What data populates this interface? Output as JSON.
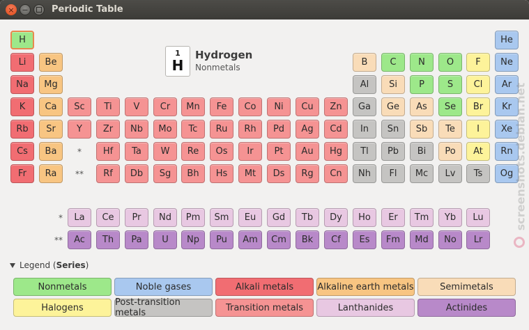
{
  "window": {
    "title": "Periodic Table"
  },
  "selected": {
    "number": "1",
    "symbol": "H",
    "name": "Hydrogen",
    "series": "Nonmetals"
  },
  "legend": {
    "toggle_prefix": "Legend (",
    "toggle_bold": "Series",
    "toggle_suffix": ")",
    "items": [
      {
        "label": "Nonmetals",
        "cls": "c-nonmetal"
      },
      {
        "label": "Noble gases",
        "cls": "c-noble"
      },
      {
        "label": "Alkali metals",
        "cls": "c-alkali"
      },
      {
        "label": "Alkaline earth metals",
        "cls": "c-alkaline"
      },
      {
        "label": "Semimetals",
        "cls": "c-semimetal"
      },
      {
        "label": "Halogens",
        "cls": "c-halogen"
      },
      {
        "label": "Post-transition metals",
        "cls": "c-post"
      },
      {
        "label": "Transition metals",
        "cls": "c-transition"
      },
      {
        "label": "Lanthanides",
        "cls": "c-lanth"
      },
      {
        "label": "Actinides",
        "cls": "c-actin"
      }
    ]
  },
  "markers": {
    "lanthanide": "*",
    "actinide": "**"
  },
  "watermark": "screenshots.debian.net",
  "elements": [
    {
      "s": "H",
      "r": 1,
      "c": 1,
      "t": "c-nonmetal",
      "sel": true
    },
    {
      "s": "He",
      "r": 1,
      "c": 18,
      "t": "c-noble"
    },
    {
      "s": "Li",
      "r": 2,
      "c": 1,
      "t": "c-alkali"
    },
    {
      "s": "Be",
      "r": 2,
      "c": 2,
      "t": "c-alkaline"
    },
    {
      "s": "B",
      "r": 2,
      "c": 13,
      "t": "c-semimetal"
    },
    {
      "s": "C",
      "r": 2,
      "c": 14,
      "t": "c-nonmetal"
    },
    {
      "s": "N",
      "r": 2,
      "c": 15,
      "t": "c-nonmetal"
    },
    {
      "s": "O",
      "r": 2,
      "c": 16,
      "t": "c-nonmetal"
    },
    {
      "s": "F",
      "r": 2,
      "c": 17,
      "t": "c-halogen"
    },
    {
      "s": "Ne",
      "r": 2,
      "c": 18,
      "t": "c-noble"
    },
    {
      "s": "Na",
      "r": 3,
      "c": 1,
      "t": "c-alkali"
    },
    {
      "s": "Mg",
      "r": 3,
      "c": 2,
      "t": "c-alkaline"
    },
    {
      "s": "Al",
      "r": 3,
      "c": 13,
      "t": "c-post"
    },
    {
      "s": "Si",
      "r": 3,
      "c": 14,
      "t": "c-semimetal"
    },
    {
      "s": "P",
      "r": 3,
      "c": 15,
      "t": "c-nonmetal"
    },
    {
      "s": "S",
      "r": 3,
      "c": 16,
      "t": "c-nonmetal"
    },
    {
      "s": "Cl",
      "r": 3,
      "c": 17,
      "t": "c-halogen"
    },
    {
      "s": "Ar",
      "r": 3,
      "c": 18,
      "t": "c-noble"
    },
    {
      "s": "K",
      "r": 4,
      "c": 1,
      "t": "c-alkali"
    },
    {
      "s": "Ca",
      "r": 4,
      "c": 2,
      "t": "c-alkaline"
    },
    {
      "s": "Sc",
      "r": 4,
      "c": 3,
      "t": "c-transition"
    },
    {
      "s": "Ti",
      "r": 4,
      "c": 4,
      "t": "c-transition"
    },
    {
      "s": "V",
      "r": 4,
      "c": 5,
      "t": "c-transition"
    },
    {
      "s": "Cr",
      "r": 4,
      "c": 6,
      "t": "c-transition"
    },
    {
      "s": "Mn",
      "r": 4,
      "c": 7,
      "t": "c-transition"
    },
    {
      "s": "Fe",
      "r": 4,
      "c": 8,
      "t": "c-transition"
    },
    {
      "s": "Co",
      "r": 4,
      "c": 9,
      "t": "c-transition"
    },
    {
      "s": "Ni",
      "r": 4,
      "c": 10,
      "t": "c-transition"
    },
    {
      "s": "Cu",
      "r": 4,
      "c": 11,
      "t": "c-transition"
    },
    {
      "s": "Zn",
      "r": 4,
      "c": 12,
      "t": "c-transition"
    },
    {
      "s": "Ga",
      "r": 4,
      "c": 13,
      "t": "c-post"
    },
    {
      "s": "Ge",
      "r": 4,
      "c": 14,
      "t": "c-semimetal"
    },
    {
      "s": "As",
      "r": 4,
      "c": 15,
      "t": "c-semimetal"
    },
    {
      "s": "Se",
      "r": 4,
      "c": 16,
      "t": "c-nonmetal"
    },
    {
      "s": "Br",
      "r": 4,
      "c": 17,
      "t": "c-halogen"
    },
    {
      "s": "Kr",
      "r": 4,
      "c": 18,
      "t": "c-noble"
    },
    {
      "s": "Rb",
      "r": 5,
      "c": 1,
      "t": "c-alkali"
    },
    {
      "s": "Sr",
      "r": 5,
      "c": 2,
      "t": "c-alkaline"
    },
    {
      "s": "Y",
      "r": 5,
      "c": 3,
      "t": "c-transition"
    },
    {
      "s": "Zr",
      "r": 5,
      "c": 4,
      "t": "c-transition"
    },
    {
      "s": "Nb",
      "r": 5,
      "c": 5,
      "t": "c-transition"
    },
    {
      "s": "Mo",
      "r": 5,
      "c": 6,
      "t": "c-transition"
    },
    {
      "s": "Tc",
      "r": 5,
      "c": 7,
      "t": "c-transition"
    },
    {
      "s": "Ru",
      "r": 5,
      "c": 8,
      "t": "c-transition"
    },
    {
      "s": "Rh",
      "r": 5,
      "c": 9,
      "t": "c-transition"
    },
    {
      "s": "Pd",
      "r": 5,
      "c": 10,
      "t": "c-transition"
    },
    {
      "s": "Ag",
      "r": 5,
      "c": 11,
      "t": "c-transition"
    },
    {
      "s": "Cd",
      "r": 5,
      "c": 12,
      "t": "c-transition"
    },
    {
      "s": "In",
      "r": 5,
      "c": 13,
      "t": "c-post"
    },
    {
      "s": "Sn",
      "r": 5,
      "c": 14,
      "t": "c-post"
    },
    {
      "s": "Sb",
      "r": 5,
      "c": 15,
      "t": "c-semimetal"
    },
    {
      "s": "Te",
      "r": 5,
      "c": 16,
      "t": "c-semimetal"
    },
    {
      "s": "I",
      "r": 5,
      "c": 17,
      "t": "c-halogen"
    },
    {
      "s": "Xe",
      "r": 5,
      "c": 18,
      "t": "c-noble"
    },
    {
      "s": "Cs",
      "r": 6,
      "c": 1,
      "t": "c-alkali"
    },
    {
      "s": "Ba",
      "r": 6,
      "c": 2,
      "t": "c-alkaline"
    },
    {
      "s": "Hf",
      "r": 6,
      "c": 4,
      "t": "c-transition"
    },
    {
      "s": "Ta",
      "r": 6,
      "c": 5,
      "t": "c-transition"
    },
    {
      "s": "W",
      "r": 6,
      "c": 6,
      "t": "c-transition"
    },
    {
      "s": "Re",
      "r": 6,
      "c": 7,
      "t": "c-transition"
    },
    {
      "s": "Os",
      "r": 6,
      "c": 8,
      "t": "c-transition"
    },
    {
      "s": "Ir",
      "r": 6,
      "c": 9,
      "t": "c-transition"
    },
    {
      "s": "Pt",
      "r": 6,
      "c": 10,
      "t": "c-transition"
    },
    {
      "s": "Au",
      "r": 6,
      "c": 11,
      "t": "c-transition"
    },
    {
      "s": "Hg",
      "r": 6,
      "c": 12,
      "t": "c-transition"
    },
    {
      "s": "Tl",
      "r": 6,
      "c": 13,
      "t": "c-post"
    },
    {
      "s": "Pb",
      "r": 6,
      "c": 14,
      "t": "c-post"
    },
    {
      "s": "Bi",
      "r": 6,
      "c": 15,
      "t": "c-post"
    },
    {
      "s": "Po",
      "r": 6,
      "c": 16,
      "t": "c-semimetal"
    },
    {
      "s": "At",
      "r": 6,
      "c": 17,
      "t": "c-halogen"
    },
    {
      "s": "Rn",
      "r": 6,
      "c": 18,
      "t": "c-noble"
    },
    {
      "s": "Fr",
      "r": 7,
      "c": 1,
      "t": "c-alkali"
    },
    {
      "s": "Ra",
      "r": 7,
      "c": 2,
      "t": "c-alkaline"
    },
    {
      "s": "Rf",
      "r": 7,
      "c": 4,
      "t": "c-transition"
    },
    {
      "s": "Db",
      "r": 7,
      "c": 5,
      "t": "c-transition"
    },
    {
      "s": "Sg",
      "r": 7,
      "c": 6,
      "t": "c-transition"
    },
    {
      "s": "Bh",
      "r": 7,
      "c": 7,
      "t": "c-transition"
    },
    {
      "s": "Hs",
      "r": 7,
      "c": 8,
      "t": "c-transition"
    },
    {
      "s": "Mt",
      "r": 7,
      "c": 9,
      "t": "c-transition"
    },
    {
      "s": "Ds",
      "r": 7,
      "c": 10,
      "t": "c-transition"
    },
    {
      "s": "Rg",
      "r": 7,
      "c": 11,
      "t": "c-transition"
    },
    {
      "s": "Cn",
      "r": 7,
      "c": 12,
      "t": "c-transition"
    },
    {
      "s": "Nh",
      "r": 7,
      "c": 13,
      "t": "c-post"
    },
    {
      "s": "Fl",
      "r": 7,
      "c": 14,
      "t": "c-post"
    },
    {
      "s": "Mc",
      "r": 7,
      "c": 15,
      "t": "c-post"
    },
    {
      "s": "Lv",
      "r": 7,
      "c": 16,
      "t": "c-post"
    },
    {
      "s": "Ts",
      "r": 7,
      "c": 17,
      "t": "c-post"
    },
    {
      "s": "Og",
      "r": 7,
      "c": 18,
      "t": "c-noble"
    },
    {
      "s": "La",
      "r": 8,
      "c": 3,
      "t": "c-lanth"
    },
    {
      "s": "Ce",
      "r": 8,
      "c": 4,
      "t": "c-lanth"
    },
    {
      "s": "Pr",
      "r": 8,
      "c": 5,
      "t": "c-lanth"
    },
    {
      "s": "Nd",
      "r": 8,
      "c": 6,
      "t": "c-lanth"
    },
    {
      "s": "Pm",
      "r": 8,
      "c": 7,
      "t": "c-lanth"
    },
    {
      "s": "Sm",
      "r": 8,
      "c": 8,
      "t": "c-lanth"
    },
    {
      "s": "Eu",
      "r": 8,
      "c": 9,
      "t": "c-lanth"
    },
    {
      "s": "Gd",
      "r": 8,
      "c": 10,
      "t": "c-lanth"
    },
    {
      "s": "Tb",
      "r": 8,
      "c": 11,
      "t": "c-lanth"
    },
    {
      "s": "Dy",
      "r": 8,
      "c": 12,
      "t": "c-lanth"
    },
    {
      "s": "Ho",
      "r": 8,
      "c": 13,
      "t": "c-lanth"
    },
    {
      "s": "Er",
      "r": 8,
      "c": 14,
      "t": "c-lanth"
    },
    {
      "s": "Tm",
      "r": 8,
      "c": 15,
      "t": "c-lanth"
    },
    {
      "s": "Yb",
      "r": 8,
      "c": 16,
      "t": "c-lanth"
    },
    {
      "s": "Lu",
      "r": 8,
      "c": 17,
      "t": "c-lanth"
    },
    {
      "s": "Ac",
      "r": 9,
      "c": 3,
      "t": "c-actin"
    },
    {
      "s": "Th",
      "r": 9,
      "c": 4,
      "t": "c-actin"
    },
    {
      "s": "Pa",
      "r": 9,
      "c": 5,
      "t": "c-actin"
    },
    {
      "s": "U",
      "r": 9,
      "c": 6,
      "t": "c-actin"
    },
    {
      "s": "Np",
      "r": 9,
      "c": 7,
      "t": "c-actin"
    },
    {
      "s": "Pu",
      "r": 9,
      "c": 8,
      "t": "c-actin"
    },
    {
      "s": "Am",
      "r": 9,
      "c": 9,
      "t": "c-actin"
    },
    {
      "s": "Cm",
      "r": 9,
      "c": 10,
      "t": "c-actin"
    },
    {
      "s": "Bk",
      "r": 9,
      "c": 11,
      "t": "c-actin"
    },
    {
      "s": "Cf",
      "r": 9,
      "c": 12,
      "t": "c-actin"
    },
    {
      "s": "Es",
      "r": 9,
      "c": 13,
      "t": "c-actin"
    },
    {
      "s": "Fm",
      "r": 9,
      "c": 14,
      "t": "c-actin"
    },
    {
      "s": "Md",
      "r": 9,
      "c": 15,
      "t": "c-actin"
    },
    {
      "s": "No",
      "r": 9,
      "c": 16,
      "t": "c-actin"
    },
    {
      "s": "Lr",
      "r": 9,
      "c": 17,
      "t": "c-actin"
    }
  ]
}
